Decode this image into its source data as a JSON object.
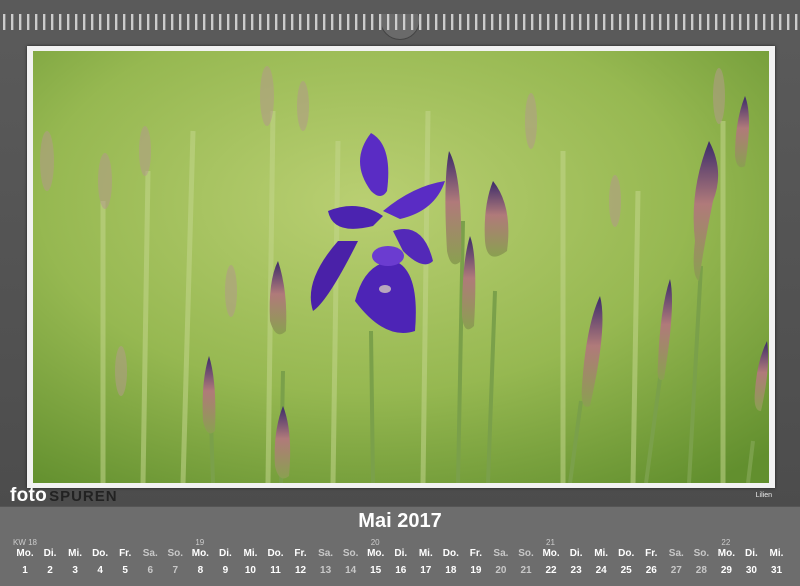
{
  "calendar": {
    "month_title": "Mai 2017",
    "brand": {
      "bold": "foto",
      "light": "SPUREN"
    },
    "photo_caption": "Lilien",
    "week_labels": [
      {
        "label": "KW 18",
        "day_index": 0
      },
      {
        "label": "19",
        "day_index": 7
      },
      {
        "label": "20",
        "day_index": 14
      },
      {
        "label": "21",
        "day_index": 21
      },
      {
        "label": "22",
        "day_index": 28
      }
    ],
    "days": [
      {
        "name": "Mo.",
        "num": "1"
      },
      {
        "name": "Di.",
        "num": "2"
      },
      {
        "name": "Mi.",
        "num": "3"
      },
      {
        "name": "Do.",
        "num": "4"
      },
      {
        "name": "Fr.",
        "num": "5"
      },
      {
        "name": "Sa.",
        "num": "6",
        "weekend": true
      },
      {
        "name": "So.",
        "num": "7",
        "weekend": true
      },
      {
        "name": "Mo.",
        "num": "8"
      },
      {
        "name": "Di.",
        "num": "9"
      },
      {
        "name": "Mi.",
        "num": "10"
      },
      {
        "name": "Do.",
        "num": "11"
      },
      {
        "name": "Fr.",
        "num": "12"
      },
      {
        "name": "Sa.",
        "num": "13",
        "weekend": true
      },
      {
        "name": "So.",
        "num": "14",
        "weekend": true
      },
      {
        "name": "Mo.",
        "num": "15"
      },
      {
        "name": "Di.",
        "num": "16"
      },
      {
        "name": "Mi.",
        "num": "17"
      },
      {
        "name": "Do.",
        "num": "18"
      },
      {
        "name": "Fr.",
        "num": "19"
      },
      {
        "name": "Sa.",
        "num": "20",
        "weekend": true
      },
      {
        "name": "So.",
        "num": "21",
        "weekend": true
      },
      {
        "name": "Mo.",
        "num": "22"
      },
      {
        "name": "Di.",
        "num": "23"
      },
      {
        "name": "Mi.",
        "num": "24"
      },
      {
        "name": "Do.",
        "num": "25"
      },
      {
        "name": "Fr.",
        "num": "26"
      },
      {
        "name": "Sa.",
        "num": "27",
        "weekend": true
      },
      {
        "name": "So.",
        "num": "28",
        "weekend": true
      },
      {
        "name": "Mo.",
        "num": "29"
      },
      {
        "name": "Di.",
        "num": "30"
      },
      {
        "name": "Mi.",
        "num": "31"
      }
    ]
  }
}
